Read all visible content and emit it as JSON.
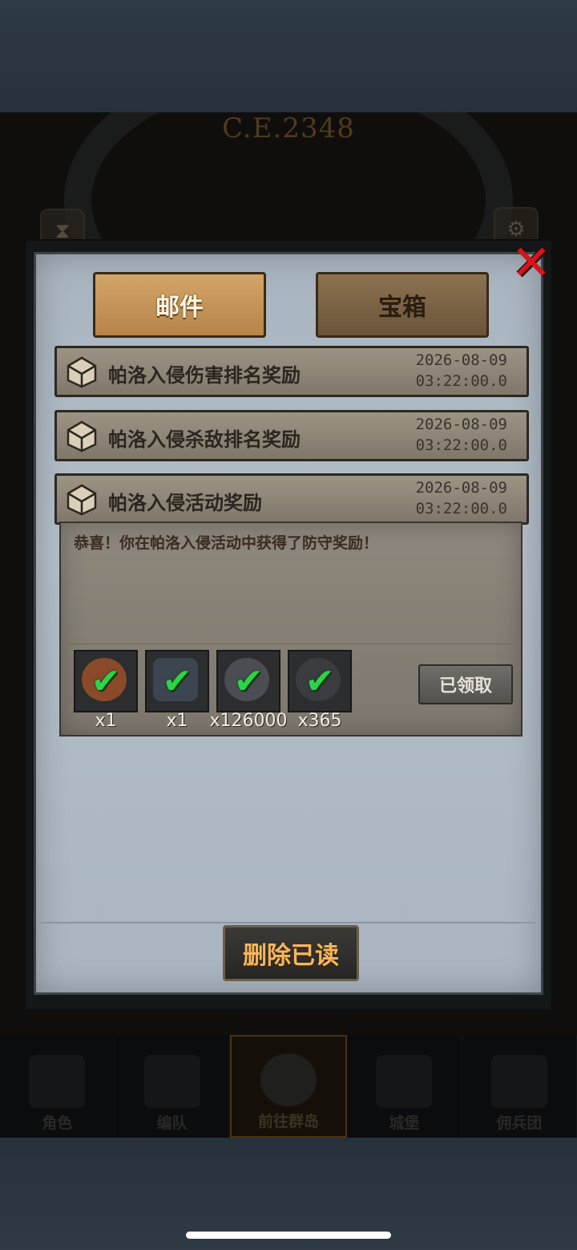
{
  "background": {
    "era": "C.E.2348",
    "nav": [
      {
        "label": "角色"
      },
      {
        "label": "编队"
      },
      {
        "label": "前往群岛"
      },
      {
        "label": "城堡"
      },
      {
        "label": "佣兵团"
      }
    ]
  },
  "dialog": {
    "close_label": "✕",
    "tabs": [
      {
        "label": "邮件",
        "active": true
      },
      {
        "label": "宝箱",
        "active": false
      }
    ],
    "mails": [
      {
        "title": "帕洛入侵伤害排名奖励",
        "date": "2026-08-09",
        "time": "03:22:00.0"
      },
      {
        "title": "帕洛入侵杀敌排名奖励",
        "date": "2026-08-09",
        "time": "03:22:00.0"
      },
      {
        "title": "帕洛入侵活动奖励",
        "date": "2026-08-09",
        "time": "03:22:00.0",
        "expanded": true
      }
    ],
    "expanded_mail": {
      "message": "恭喜！你在帕洛入侵活动中获得了防守奖励！",
      "rewards": [
        {
          "icon": "item-badge-icon",
          "qty": "x1",
          "color": "#8a4a2a"
        },
        {
          "icon": "armor-piece-icon",
          "qty": "x1",
          "color": "#3d4650"
        },
        {
          "icon": "dark-coin-icon",
          "qty": "x126000",
          "color": "#4b4d52"
        },
        {
          "icon": "dark-stone-icon",
          "qty": "x365",
          "color": "#3a3c40"
        }
      ],
      "claim_status": "已领取"
    },
    "delete_read_label": "删除已读"
  },
  "colors": {
    "check": "#2bd44a",
    "close": "#d8141a",
    "delete_text": "#f6b65a"
  }
}
